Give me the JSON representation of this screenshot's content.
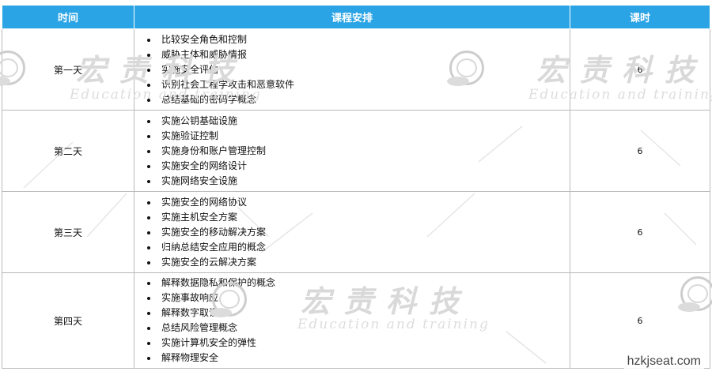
{
  "table": {
    "headers": {
      "time": "时间",
      "plan": "课程安排",
      "hours": "课时"
    },
    "rows": [
      {
        "day": "第一天",
        "hours": "6",
        "topics": [
          "比较安全角色和控制",
          "威胁主体和威胁情报",
          "实施安全评估",
          "识别社会工程学攻击和恶意软件",
          "总结基础的密码学概念"
        ]
      },
      {
        "day": "第二天",
        "hours": "6",
        "topics": [
          "实施公钥基础设施",
          "实施验证控制",
          "实施身份和账户管理控制",
          "实施安全的网络设计",
          "实施网络安全设施"
        ]
      },
      {
        "day": "第三天",
        "hours": "6",
        "topics": [
          "实施安全的网络协议",
          "实施主机安全方案",
          "实施安全的移动解决方案",
          "归纳总结安全应用的概念",
          "实施安全的云解决方案"
        ]
      },
      {
        "day": "第四天",
        "hours": "6",
        "topics": [
          "解释数据隐私和保护的概念",
          "实施事故响应",
          "解释数字取证",
          "总结风险管理概念",
          "实施计算机安全的弹性",
          "解释物理安全"
        ]
      }
    ]
  },
  "watermark": {
    "cn": "宏责科技",
    "en": "Education and training"
  },
  "site": "hzkjseat.com",
  "colors": {
    "header_bg": "#2aa4e4",
    "header_text": "#ffffff",
    "border": "#b9b9b9",
    "watermark": "#d9d9d9"
  }
}
